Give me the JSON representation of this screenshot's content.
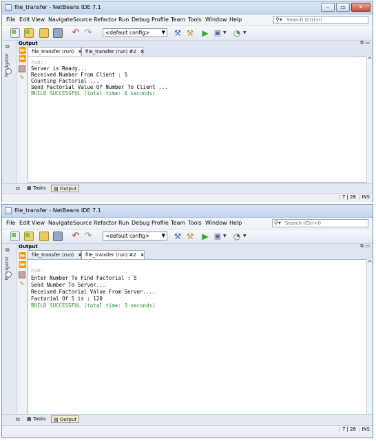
{
  "windows": [
    {
      "title": "file_transfer - NetBeans IDE 7.1",
      "menu": [
        "File",
        "Edit",
        "View",
        "Navigate",
        "Source",
        "Refactor",
        "Run",
        "Debug",
        "Profile",
        "Team",
        "Tools",
        "Window",
        "Help"
      ],
      "search_placeholder": "Search (Ctrl+I)",
      "config": "<default config>",
      "navigator_label": "Navigator",
      "output_title": "Output",
      "tabs": [
        {
          "label": "file_transfer (run)",
          "close": "×",
          "active": true
        },
        {
          "label": "file_transfer (run) #2",
          "close": "×",
          "active": false
        }
      ],
      "lines": [
        {
          "text": "run:",
          "style": "grey"
        },
        {
          "text": "Server is Ready...",
          "style": "normal"
        },
        {
          "text": "Received Number From Client : 5",
          "style": "normal"
        },
        {
          "text": "Counting Factorial ...",
          "style": "normal"
        },
        {
          "text": "Send Factorial Value Of Number To Client ...",
          "style": "normal"
        },
        {
          "text": "BUILD SUCCESSFUL (total time: 6 seconds)",
          "style": "green"
        }
      ],
      "bottom_tabs": {
        "tasks": "Tasks",
        "output": "Output"
      },
      "status": {
        "position": "7 | 28",
        "mode": "INS"
      }
    },
    {
      "title": "file_transfer - NetBeans IDE 7.1",
      "menu": [
        "File",
        "Edit",
        "View",
        "Navigate",
        "Source",
        "Refactor",
        "Run",
        "Debug",
        "Profile",
        "Team",
        "Tools",
        "Window",
        "Help"
      ],
      "search_placeholder": "Search (Ctrl+I)",
      "config": "<default config>",
      "navigator_label": "Navigator",
      "output_title": "Output",
      "tabs": [
        {
          "label": "file_transfer (run)",
          "close": "×",
          "active": false
        },
        {
          "label": "file_transfer (run) #2",
          "close": "×",
          "active": true
        }
      ],
      "lines": [
        {
          "text": "run:",
          "style": "grey"
        },
        {
          "text": "Enter Number To Find Factorial : 5",
          "style": "normal"
        },
        {
          "text": "Send Number To Server...",
          "style": "normal"
        },
        {
          "text": "Received Factorial Value From Server....",
          "style": "normal"
        },
        {
          "text": "Factorial Of 5 is : 120",
          "style": "normal"
        },
        {
          "text": "BUILD SUCCESSFUL (total time: 3 seconds)",
          "style": "green"
        }
      ],
      "bottom_tabs": {
        "tasks": "Tasks",
        "output": "Output"
      },
      "status": {
        "position": "7 | 28",
        "mode": "INS"
      }
    }
  ]
}
